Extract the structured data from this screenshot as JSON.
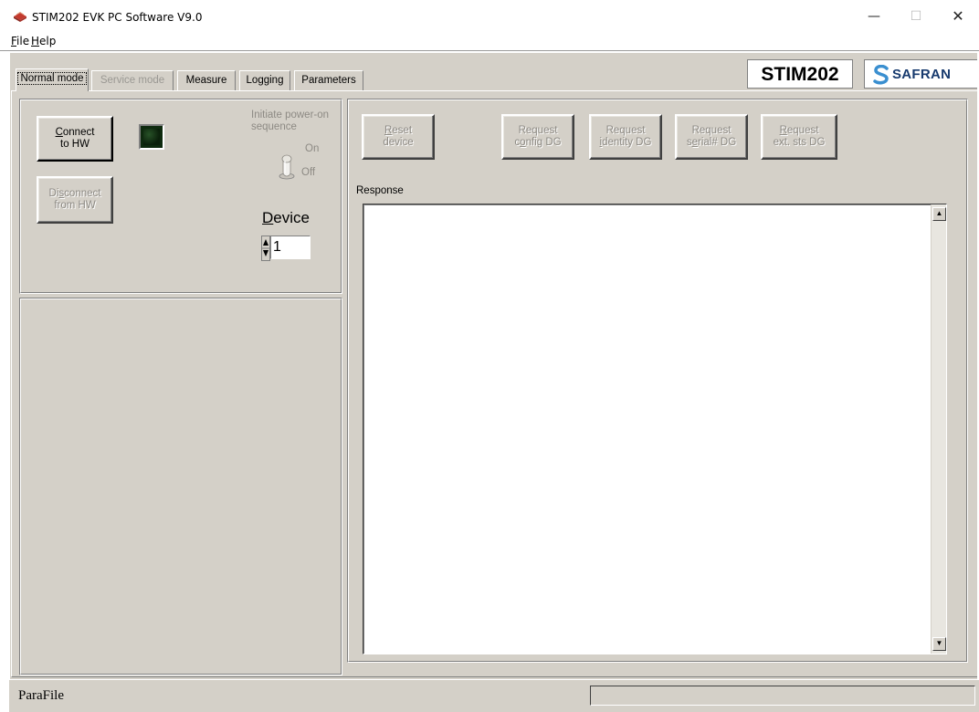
{
  "window": {
    "title": "STIM202 EVK PC Software V9.0",
    "minimize_glyph": "—",
    "maximize_glyph": "☐",
    "close_glyph": "✕"
  },
  "menu": {
    "file": {
      "accel": "F",
      "rest": "ile"
    },
    "help": {
      "accel": "H",
      "rest": "elp"
    }
  },
  "tabs": [
    {
      "label": "Normal mode",
      "state": "active"
    },
    {
      "label": "Service mode",
      "state": "disabled"
    },
    {
      "label": "Measure",
      "state": "normal"
    },
    {
      "label": "Logging",
      "state": "normal"
    },
    {
      "label": "Parameters",
      "state": "normal"
    }
  ],
  "branding": {
    "product": "STIM202",
    "company": "SAFRAN"
  },
  "connection": {
    "connect_button": {
      "line1_accel": "C",
      "line1_rest": "onnect",
      "line2": "to HW"
    },
    "disconnect_button": {
      "line1_pre": "Di",
      "line1_accel": "s",
      "line1_rest": "connect",
      "line2": "from HW"
    },
    "power_on_label_line1": "Initiate power-on",
    "power_on_label_line2": "sequence",
    "toggle_on": "On",
    "toggle_off": "Off",
    "device_label_accel": "D",
    "device_label_rest": "evice",
    "device_value": "1"
  },
  "actions": {
    "reset": {
      "line1_accel": "R",
      "line1_rest": "eset",
      "line2": "device"
    },
    "config": {
      "line1": "Request",
      "line2_pre": "c",
      "line2_accel": "o",
      "line2_rest": "nfig DG"
    },
    "identity": {
      "line1": "Request",
      "line2_accel": "i",
      "line2_rest": "dentity DG"
    },
    "serial": {
      "line1": "Request",
      "line2_pre": "s",
      "line2_accel": "e",
      "line2_rest": "rial# DG"
    },
    "extsts": {
      "line1_accel": "R",
      "line1_rest": "equest",
      "line2": "ext. sts DG"
    }
  },
  "response": {
    "label": "Response",
    "text": ""
  },
  "statusbar": {
    "left_text": "ParaFile",
    "right_text": ""
  },
  "colors": {
    "face": "#d4d0c8",
    "led_off": "#0e2a0e",
    "safran_blue": "#173a6e"
  }
}
